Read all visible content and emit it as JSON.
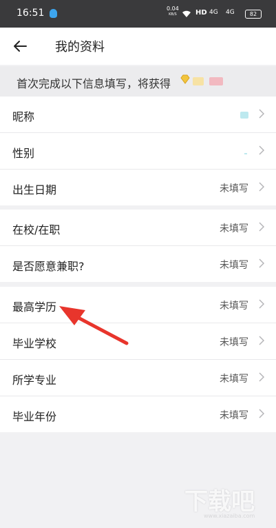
{
  "status_bar": {
    "time": "16:51",
    "net_speed": "0.04",
    "net_unit": "KB/S",
    "hd": "HD",
    "signal1": "4G",
    "signal2": "4G",
    "battery": "82"
  },
  "header": {
    "title": "我的资料"
  },
  "banner": {
    "text": "首次完成以下信息填写，将获得"
  },
  "groups": [
    {
      "rows": [
        {
          "label": "昵称",
          "value": ""
        },
        {
          "label": "性别",
          "value": ""
        },
        {
          "label": "出生日期",
          "value": "未填写"
        }
      ]
    },
    {
      "rows": [
        {
          "label": "在校/在职",
          "value": "未填写"
        },
        {
          "label": "是否愿意兼职?",
          "value": "未填写"
        }
      ]
    },
    {
      "rows": [
        {
          "label": "最高学历",
          "value": "未填写"
        },
        {
          "label": "毕业学校",
          "value": "未填写"
        },
        {
          "label": "所学专业",
          "value": "未填写"
        },
        {
          "label": "毕业年份",
          "value": "未填写"
        }
      ]
    }
  ],
  "watermark": {
    "text": "下载吧",
    "url": "www.xiazaiba.com"
  },
  "colors": {
    "accent_arrow": "#e8352c",
    "status_bar": "#3a3a3c"
  }
}
